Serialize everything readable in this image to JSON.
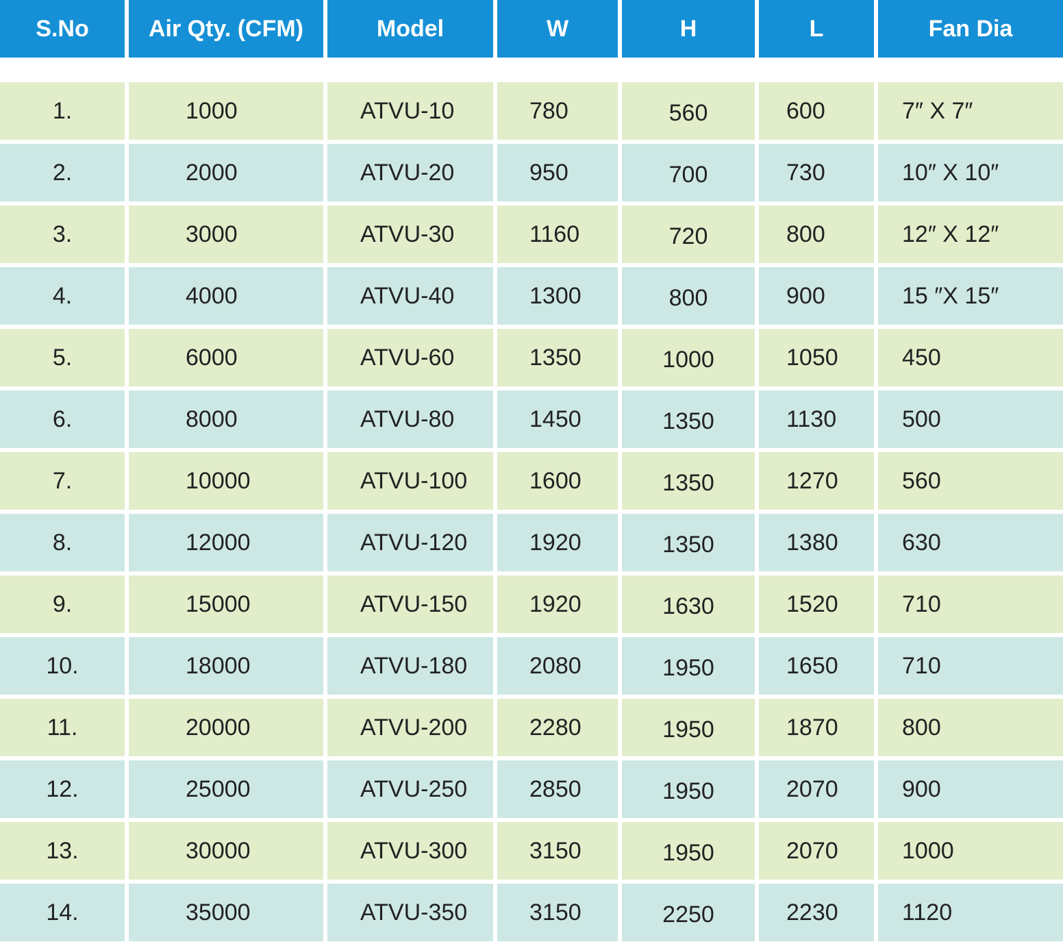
{
  "headers": [
    "S.No",
    "Air Qty. (CFM)",
    "Model",
    "W",
    "H",
    "L",
    "Fan Dia"
  ],
  "rows": [
    [
      "1.",
      "1000",
      "ATVU-10",
      "780",
      "560",
      "600",
      "7″ X 7″"
    ],
    [
      "2.",
      "2000",
      "ATVU-20",
      "950",
      "700",
      "730",
      "10″ X 10″"
    ],
    [
      "3.",
      "3000",
      "ATVU-30",
      "1160",
      "720",
      "800",
      "12″ X 12″"
    ],
    [
      "4.",
      "4000",
      "ATVU-40",
      "1300",
      "800",
      "900",
      "15 ″X 15″"
    ],
    [
      "5.",
      "6000",
      "ATVU-60",
      "1350",
      "1000",
      "1050",
      "450"
    ],
    [
      "6.",
      "8000",
      "ATVU-80",
      "1450",
      "1350",
      "1130",
      "500"
    ],
    [
      "7.",
      "10000",
      "ATVU-100",
      "1600",
      "1350",
      "1270",
      "560"
    ],
    [
      "8.",
      "12000",
      "ATVU-120",
      "1920",
      "1350",
      "1380",
      "630"
    ],
    [
      "9.",
      "15000",
      "ATVU-150",
      "1920",
      "1630",
      "1520",
      "710"
    ],
    [
      "10.",
      "18000",
      "ATVU-180",
      "2080",
      "1950",
      "1650",
      "710"
    ],
    [
      "11.",
      "20000",
      "ATVU-200",
      "2280",
      "1950",
      "1870",
      "800"
    ],
    [
      "12.",
      "25000",
      "ATVU-250",
      "2850",
      "1950",
      "2070",
      "900"
    ],
    [
      "13.",
      "30000",
      "ATVU-300",
      "3150",
      "1950",
      "2070",
      "1000"
    ],
    [
      "14.",
      "35000",
      "ATVU-350",
      "3150",
      "2250",
      "2230",
      "1120"
    ]
  ],
  "colors": {
    "header_bg": "#1590d6",
    "header_text": "#ffffff",
    "row_odd_bg": "#e2edca",
    "row_even_bg": "#cde8e4",
    "cell_text": "#222222"
  }
}
